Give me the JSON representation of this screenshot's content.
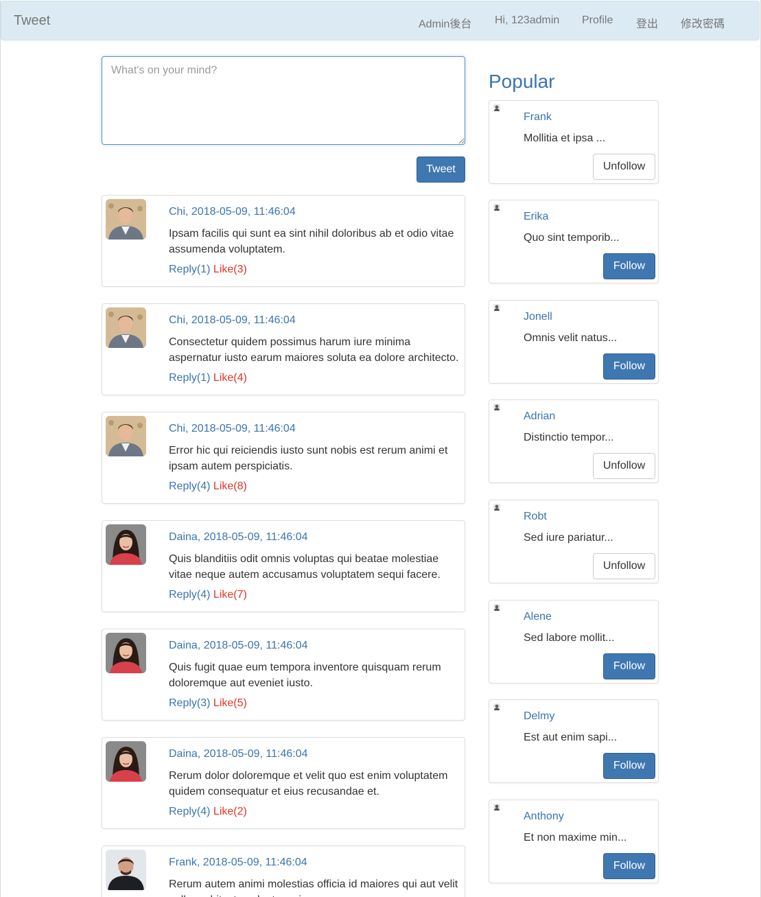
{
  "navbar": {
    "brand": "Tweet",
    "links": [
      "Admin後台",
      "Hi, 123admin",
      "Profile",
      "登出",
      "修改密碼"
    ]
  },
  "compose": {
    "placeholder": "What's on your mind?",
    "button_label": "Tweet"
  },
  "tweets": [
    {
      "header": "Chi, 2018-05-09, 11:46:04",
      "body": "Ipsam facilis qui sunt ea sint nihil doloribus ab et odio vitae assumenda voluptatem.",
      "reply": "Reply(1)",
      "like": "Like(3)",
      "avatar": "man-portrait"
    },
    {
      "header": "Chi, 2018-05-09, 11:46:04",
      "body": "Consectetur quidem possimus harum iure minima aspernatur iusto earum maiores soluta ea dolore architecto.",
      "reply": "Reply(1)",
      "like": "Like(4)",
      "avatar": "man-portrait"
    },
    {
      "header": "Chi, 2018-05-09, 11:46:04",
      "body": "Error hic qui reiciendis iusto sunt nobis est rerum animi et ipsam autem perspiciatis.",
      "reply": "Reply(4)",
      "like": "Like(8)",
      "avatar": "man-portrait"
    },
    {
      "header": "Daina, 2018-05-09, 11:46:04",
      "body": "Quis blanditiis odit omnis voluptas qui beatae molestiae vitae neque autem accusamus voluptatem sequi facere.",
      "reply": "Reply(4)",
      "like": "Like(7)",
      "avatar": "woman-portrait"
    },
    {
      "header": "Daina, 2018-05-09, 11:46:04",
      "body": "Quis fugit quae eum tempora inventore quisquam rerum doloremque aut eveniet iusto.",
      "reply": "Reply(3)",
      "like": "Like(5)",
      "avatar": "woman-portrait"
    },
    {
      "header": "Daina, 2018-05-09, 11:46:04",
      "body": "Rerum dolor doloremque et velit quo est enim voluptatem quidem consequatur et eius recusandae et.",
      "reply": "Reply(4)",
      "like": "Like(2)",
      "avatar": "woman-portrait"
    },
    {
      "header": "Frank, 2018-05-09, 11:46:04",
      "body": "Rerum autem animi molestias officia id maiores qui aut velit nulla architecto voluptas minus.",
      "reply": "",
      "like": "",
      "avatar": "man-portrait-dark"
    }
  ],
  "popular": {
    "title": "Popular",
    "users": [
      {
        "name": "Frank",
        "desc": "Mollitia et ipsa ...",
        "button": "Unfollow",
        "following": true
      },
      {
        "name": "Erika",
        "desc": "Quo sint temporib...",
        "button": "Follow",
        "following": false
      },
      {
        "name": "Jonell",
        "desc": "Omnis velit natus...",
        "button": "Follow",
        "following": false
      },
      {
        "name": "Adrian",
        "desc": "Distinctio tempor...",
        "button": "Unfollow",
        "following": true
      },
      {
        "name": "Robt",
        "desc": "Sed iure pariatur...",
        "button": "Unfollow",
        "following": true
      },
      {
        "name": "Alene",
        "desc": "Sed labore mollit...",
        "button": "Follow",
        "following": false
      },
      {
        "name": "Delmy",
        "desc": "Est aut enim sapi...",
        "button": "Follow",
        "following": false
      },
      {
        "name": "Anthony",
        "desc": "Et non maxime min...",
        "button": "Follow",
        "following": false
      }
    ]
  },
  "colors": {
    "navbar_bg": "#dcebf3",
    "link_blue": "#3a74b0",
    "primary_button": "#3f77b1",
    "like_red": "#e0352b"
  }
}
